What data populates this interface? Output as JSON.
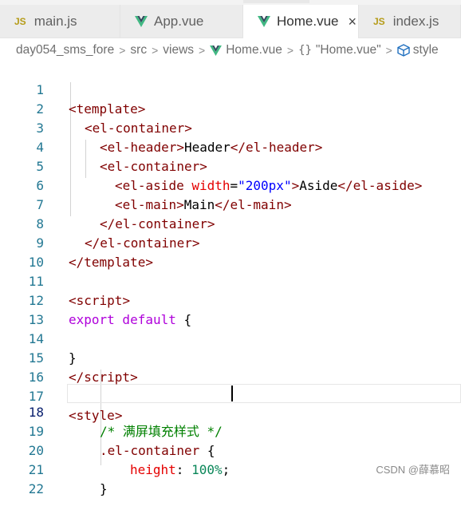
{
  "tabs": [
    {
      "label": "main.js",
      "icon": "js-icon",
      "icon_text": "JS",
      "active": false
    },
    {
      "label": "App.vue",
      "icon": "vue-icon",
      "active": false
    },
    {
      "label": "Home.vue",
      "icon": "vue-icon",
      "active": true,
      "close": "×"
    },
    {
      "label": "index.js",
      "icon": "js-icon",
      "icon_text": "JS",
      "active": false
    }
  ],
  "breadcrumb": {
    "project": "day054_sms_fore",
    "folder1": "src",
    "folder2": "views",
    "file": "Home.vue",
    "braces": "{}",
    "symbol": "\"Home.vue\"",
    "section": "style",
    "separator": ">"
  },
  "editor": {
    "line_numbers": [
      "1",
      "2",
      "3",
      "4",
      "5",
      "6",
      "7",
      "8",
      "9",
      "10",
      "11",
      "12",
      "13",
      "14",
      "15",
      "16",
      "17",
      "18",
      "19",
      "20",
      "21",
      "22"
    ],
    "active_line": "18",
    "tokens": {
      "l1": [
        "<",
        "template",
        ">"
      ],
      "l2": [
        "<",
        "el-container",
        ">"
      ],
      "l3": [
        "<",
        "el-header",
        ">",
        "Header",
        "</",
        "el-header",
        ">"
      ],
      "l4": [
        "<",
        "el-container",
        ">"
      ],
      "l5": [
        "<",
        "el-aside",
        " width",
        "=",
        "\"200px\"",
        ">",
        "Aside",
        "</",
        "el-aside",
        ">"
      ],
      "l6": [
        "<",
        "el-main",
        ">",
        "Main",
        "</",
        "el-main",
        ">"
      ],
      "l7": [
        "</",
        "el-container",
        ">"
      ],
      "l8": [
        "</",
        "el-container",
        ">"
      ],
      "l9": [
        "</",
        "template",
        ">"
      ],
      "l11": [
        "<",
        "script",
        ">"
      ],
      "l12": [
        "export",
        " default",
        " {"
      ],
      "l14": [
        "}"
      ],
      "l15": [
        "</",
        "script",
        ">"
      ],
      "l17": [
        "<",
        "style",
        ">"
      ],
      "l18": [
        "/* 满屏填充样式 */"
      ],
      "l19": [
        ".el-container",
        " {"
      ],
      "l20": [
        "height",
        ": ",
        "100%",
        ";"
      ],
      "l21": [
        "}"
      ]
    }
  },
  "watermark": "CSDN @薛慕昭",
  "colors": {
    "tag": "#800000",
    "attr": "#e50000",
    "string": "#0000ff",
    "keyword": "#af00db",
    "comment": "#008000",
    "number": "#098658",
    "line_number": "#237893"
  }
}
